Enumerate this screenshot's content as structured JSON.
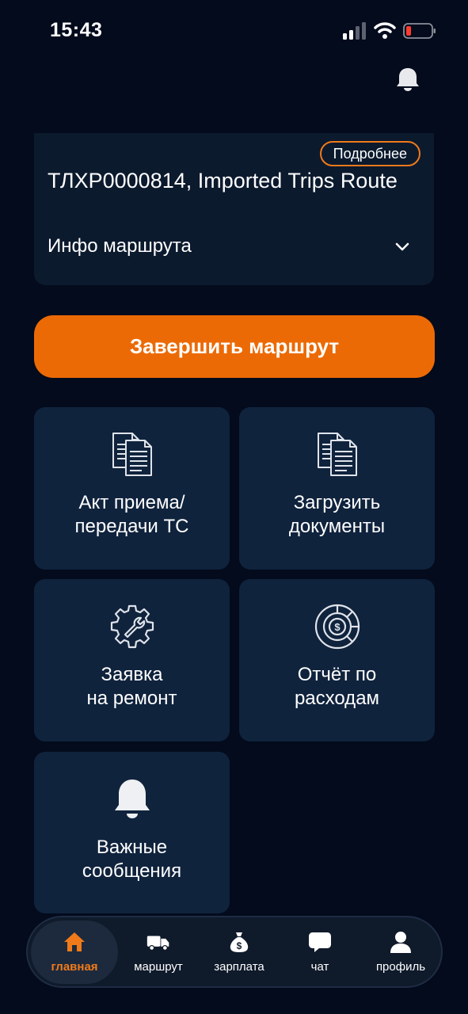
{
  "status_bar": {
    "time": "15:43",
    "icons": [
      "signal-icon",
      "wifi-icon",
      "battery-low-icon"
    ],
    "battery_color": "#ff3b30"
  },
  "header": {
    "notifications_icon": "bell-icon"
  },
  "route_card": {
    "details_label": "Подробнее",
    "title": "ТЛХР0000814, Imported Trips Route",
    "info_label": "Инфо маршрута",
    "info_icon": "chevron-down-icon"
  },
  "primary_action": {
    "label": "Завершить маршрут",
    "color": "#ec6a05"
  },
  "tiles": [
    {
      "label": "Акт приема/\nпередачи ТС",
      "icon": "documents-icon"
    },
    {
      "label": "Загрузить\nдокументы",
      "icon": "documents-icon"
    },
    {
      "label": "Заявка\nна ремонт",
      "icon": "gear-wrench-icon"
    },
    {
      "label": "Отчёт по\nрасходам",
      "icon": "expense-chart-icon"
    },
    {
      "label": "Важные\nсообщения",
      "icon": "bell-icon"
    }
  ],
  "bottom_nav": {
    "active_color": "#f07a1a",
    "items": [
      {
        "label": "главная",
        "icon": "home-icon",
        "active": true
      },
      {
        "label": "маршрут",
        "icon": "truck-icon",
        "active": false
      },
      {
        "label": "зарплата",
        "icon": "money-bag-icon",
        "active": false
      },
      {
        "label": "чат",
        "icon": "chat-icon",
        "active": false
      },
      {
        "label": "профиль",
        "icon": "user-icon",
        "active": false
      }
    ]
  }
}
